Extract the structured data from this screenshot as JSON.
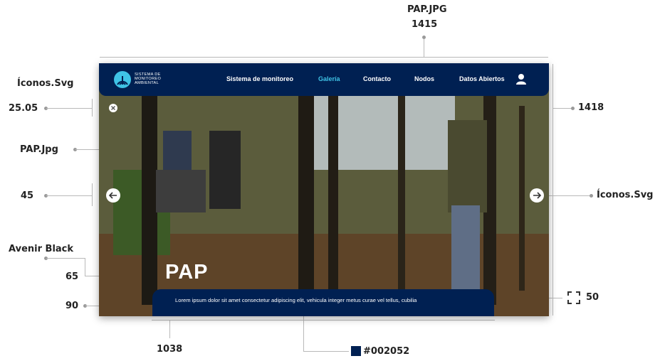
{
  "annotations": {
    "top_file": "PAP.JPG",
    "top_width": "1415",
    "left_icons": "Íconos.Svg",
    "left_icon_size": "25.05",
    "left_image": "PAP.Jpg",
    "left_arrow_size": "45",
    "font_name": "Avenir Black",
    "font_size": "65",
    "caption_height": "90",
    "bottom_width": "1038",
    "right_height": "1418",
    "right_icons": "Íconos.Svg",
    "expand_value": "50",
    "caption_color": "#002052"
  },
  "header": {
    "logo_line1": "SISTEMA DE",
    "logo_line2": "MONITOREO",
    "logo_line3": "AMBIENTAL",
    "nav": [
      {
        "label": "Sistema de monitoreo",
        "active": false
      },
      {
        "label": "Galería",
        "active": true
      },
      {
        "label": "Contacto",
        "active": false
      },
      {
        "label": "Nodos",
        "active": false
      },
      {
        "label": "Datos Abiertos",
        "active": false
      }
    ]
  },
  "hero": {
    "title": "PAP",
    "caption": "Lorem ipsum dolor sit amet consectetur adipiscing elit, vehicula integer metus curae vel tellus, cubilia"
  },
  "colors": {
    "navy": "#002052",
    "accent": "#3fc3e6"
  },
  "icons": {
    "logo": "logo-icon",
    "user": "user-icon",
    "close": "close-icon",
    "prev": "arrow-left-icon",
    "next": "arrow-right-icon",
    "expand": "expand-icon"
  }
}
